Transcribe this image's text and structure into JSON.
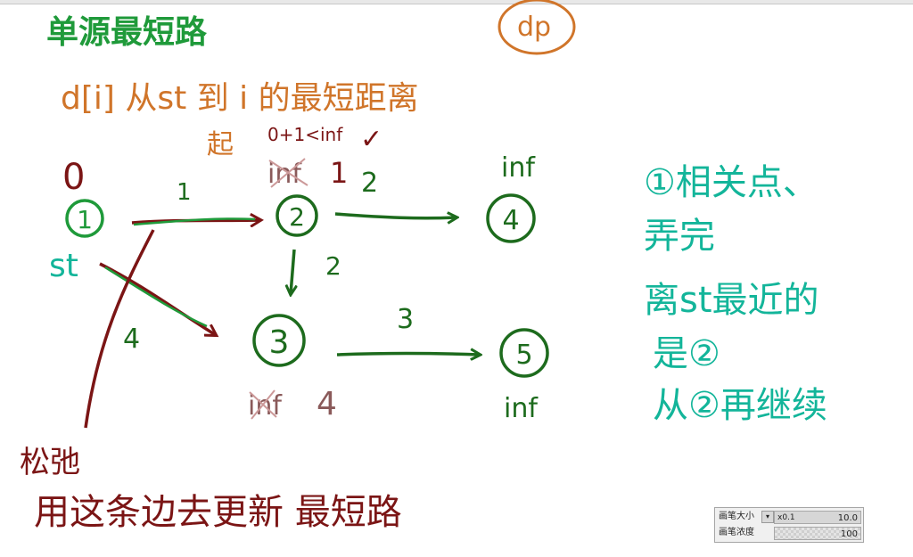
{
  "colors": {
    "green": "#1f9a3a",
    "dark_green": "#1d6b1d",
    "orange": "#d0752a",
    "dark_red": "#7b1515",
    "teal": "#13b59a",
    "gray_red": "#8a5a5a"
  },
  "notes": {
    "title_green": "单源最短路",
    "dp_label": "dp",
    "definition": "d[i] 从st 到 i 的最短距离",
    "start_label": "起",
    "compare": "0+1<inf",
    "check_mark": "✓",
    "bottom_line1": "松弛",
    "bottom_line2": "用这条边去更新 最短路"
  },
  "graph": {
    "nodes": [
      {
        "id": "1",
        "top_label": "0",
        "side_label": "st"
      },
      {
        "id": "2",
        "top_label": "inf",
        "crossed": true
      },
      {
        "id": "3",
        "bottom_label": "inf",
        "crossed": true,
        "new_value": "4"
      },
      {
        "id": "4",
        "top_label": "inf"
      },
      {
        "id": "5",
        "bottom_label": "inf"
      }
    ],
    "edges": [
      {
        "from": "1",
        "to": "2",
        "weight": "1"
      },
      {
        "from": "2",
        "to": "4",
        "weight": "2"
      },
      {
        "from": "2",
        "to": "3",
        "weight": "2"
      },
      {
        "from": "1",
        "to": "3",
        "weight": "4"
      },
      {
        "from": "3",
        "to": "5",
        "weight": "3"
      }
    ],
    "node2_extra": "1"
  },
  "right_notes": {
    "line1": "①相关点、",
    "line2": "弄完",
    "line3": "离st最近的",
    "line4": "是②",
    "line5": "从②再继续"
  },
  "brush_panel": {
    "size_label": "画笔大小",
    "size_min": "x0.1",
    "size_value": "10.0",
    "density_label": "画笔浓度",
    "density_value": "100"
  }
}
